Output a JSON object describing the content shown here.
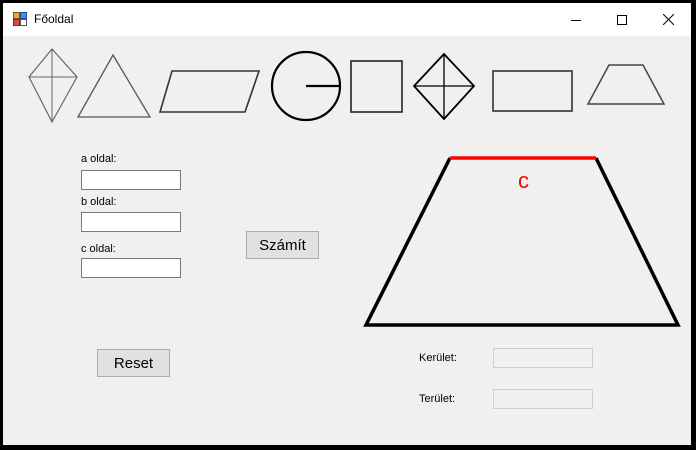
{
  "window": {
    "title": "Főoldal"
  },
  "inputs": {
    "a_label": "a oldal:",
    "b_label": "b oldal:",
    "c_label": "c oldal:",
    "a_value": "",
    "b_value": "",
    "c_value": ""
  },
  "buttons": {
    "calculate": "Számít",
    "reset": "Reset"
  },
  "results": {
    "perimeter_label": "Kerület:",
    "area_label": "Terület:",
    "perimeter_value": "",
    "area_value": ""
  },
  "preview": {
    "highlight_label": "c",
    "highlight_color": "#ff0000"
  },
  "shapes": [
    "kite-icon",
    "triangle-icon",
    "parallelogram-icon",
    "circle-icon",
    "square-icon",
    "rhombus-icon",
    "rectangle-icon",
    "trapezoid-icon"
  ]
}
